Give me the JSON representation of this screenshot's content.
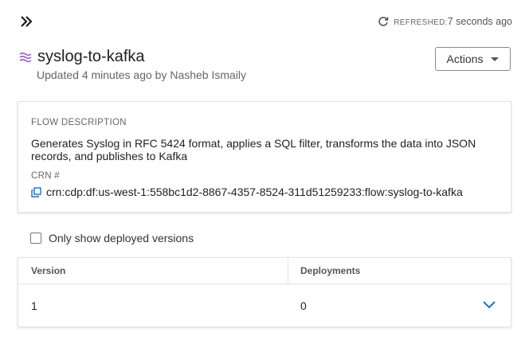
{
  "header": {
    "expand_icon": "double-chevron-right-icon",
    "refresh_icon": "refresh-icon",
    "refreshed_label": "REFRESHED:",
    "refreshed_value": "7 seconds ago"
  },
  "flow": {
    "icon": "flow-layers-icon",
    "title": "syslog-to-kafka",
    "subtitle": "Updated 4 minutes ago by Nasheb Ismaily"
  },
  "actions": {
    "label": "Actions",
    "icon": "caret-down-icon"
  },
  "description_card": {
    "label": "FLOW DESCRIPTION",
    "text": "Generates Syslog in RFC 5424 format, applies a SQL filter, transforms the data into JSON records, and publishes to Kafka",
    "crn_label": "CRN #",
    "crn_icon": "copy-icon",
    "crn_value": "crn:cdp:df:us-west-1:558bc1d2-8867-4357-8524-311d51259233:flow:syslog-to-kafka"
  },
  "filter": {
    "label": "Only show deployed versions",
    "checked": false
  },
  "table": {
    "columns": [
      "Version",
      "Deployments"
    ],
    "rows": [
      {
        "version": "1",
        "deployments": "0"
      }
    ],
    "expand_icon": "chevron-down-icon"
  },
  "colors": {
    "accent": "#1a73c8",
    "flow_icon": "#9b59d0"
  }
}
